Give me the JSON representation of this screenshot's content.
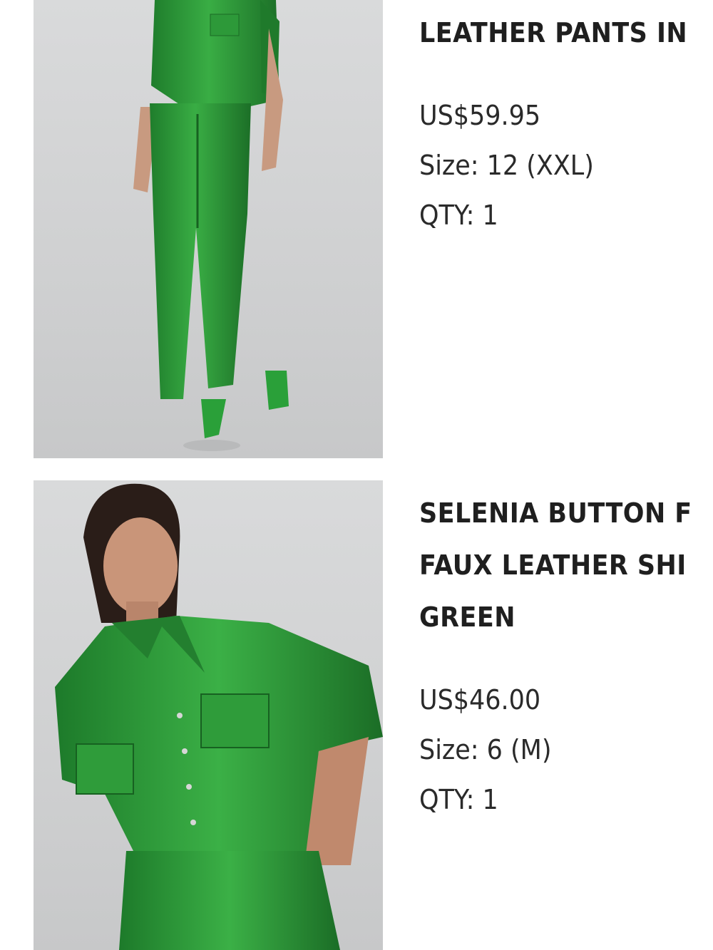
{
  "items": [
    {
      "title_lines": [
        "LEATHER PANTS IN"
      ],
      "price": "US$59.95",
      "size": "Size: 12 (XXL)",
      "qty": "QTY: 1",
      "image": "green faux leather pants product photo"
    },
    {
      "title_lines": [
        "SELENIA BUTTON F",
        "FAUX LEATHER SHI",
        "GREEN"
      ],
      "price": "US$46.00",
      "size": "Size: 6 (M)",
      "qty": "QTY: 1",
      "image": "green faux leather shirt product photo"
    }
  ],
  "colors": {
    "product_green": "#2f9a3a",
    "text": "#1f1f1f",
    "photo_bg": "#d3d4d5"
  }
}
